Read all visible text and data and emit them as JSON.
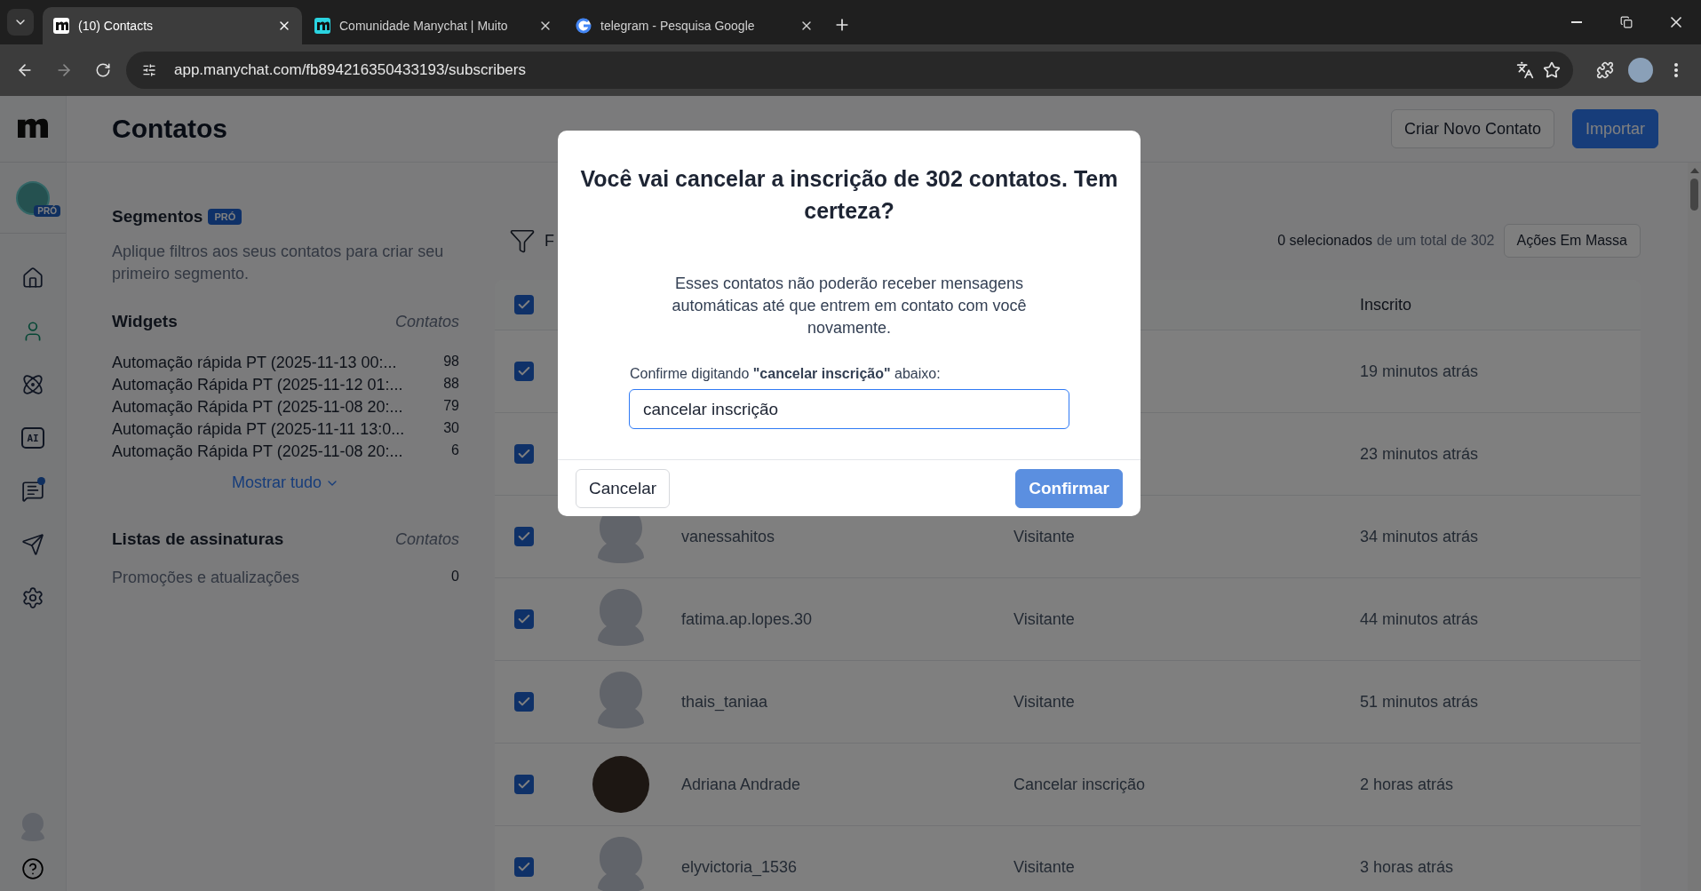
{
  "browser": {
    "tabs": [
      {
        "title": "(10) Contacts",
        "selected": true
      },
      {
        "title": "Comunidade Manychat | Muito",
        "selected": false
      },
      {
        "title": "telegram - Pesquisa Google",
        "selected": false
      }
    ],
    "url": "app.manychat.com/fb894216350433193/subscribers"
  },
  "nav": {
    "account_badge": "PRÓ",
    "items": [
      {
        "selected": false
      },
      {
        "selected": true
      },
      {
        "selected": false
      },
      {
        "selected": false,
        "label": "AI"
      },
      {
        "selected": false,
        "badge": true
      },
      {
        "selected": false
      },
      {
        "selected": false
      }
    ]
  },
  "header": {
    "title": "Contatos",
    "buttons": [
      {
        "label": "Criar Novo Contato",
        "kind": "secondary"
      },
      {
        "label": "Importar",
        "kind": "primary"
      }
    ]
  },
  "segments": {
    "title": "Segmentos",
    "badge": "PRÓ",
    "description": "Aplique filtros aos seus contatos para criar seu primeiro segmento."
  },
  "widgets": {
    "title": "Widgets",
    "column": "Contatos",
    "items": [
      {
        "name": "Automação rápida PT (2025-11-13 00:...",
        "count": "98"
      },
      {
        "name": "Automação Rápida PT (2025-11-12 01:...",
        "count": "88"
      },
      {
        "name": "Automação Rápida PT (2025-11-08 20:...",
        "count": "79"
      },
      {
        "name": "Automação rápida PT (2025-11-11 13:0...",
        "count": "30"
      },
      {
        "name": "Automação Rápida PT (2025-11-08 20:...",
        "count": "6"
      }
    ],
    "show_all": "Mostrar tudo"
  },
  "subscription_lists": {
    "title": "Listas de assinaturas",
    "column": "Contatos",
    "items": [
      {
        "name": "Promoções e atualizações",
        "count": "0"
      }
    ]
  },
  "toolbar": {
    "filter_label": "F",
    "selected_count": "0 selecionados",
    "total": "de um total de 302",
    "bulk_button": "Ações Em Massa"
  },
  "table": {
    "header_checked": true,
    "columns": [
      {
        "label": "Inscrito"
      }
    ],
    "rows": [
      {
        "checked": true,
        "subscribed": "19 minutos atrás"
      },
      {
        "checked": true,
        "subscribed": "23 minutos atrás"
      },
      {
        "checked": true,
        "kind": "silhouette",
        "name": "vanessahitos",
        "status": "Visitante",
        "subscribed": "34 minutos atrás"
      },
      {
        "checked": true,
        "kind": "silhouette",
        "name": "fatima.ap.lopes.30",
        "status": "Visitante",
        "subscribed": "44 minutos atrás"
      },
      {
        "checked": true,
        "kind": "silhouette",
        "name": "thais_taniaa",
        "status": "Visitante",
        "subscribed": "51 minutos atrás"
      },
      {
        "checked": true,
        "kind": "photo",
        "name": "Adriana Andrade",
        "status": "Cancelar inscrição",
        "subscribed": "2 horas atrás"
      },
      {
        "checked": true,
        "kind": "silhouette",
        "name": "elyvictoria_1536",
        "status": "Visitante",
        "subscribed": "3 horas atrás"
      }
    ]
  },
  "dialog": {
    "title": "Você vai cancelar a inscrição de 302 contatos. Tem certeza?",
    "message": "Esses contatos não poderão receber mensagens automáticas até que entrem em contato com você novamente.",
    "prompt": "Confirme digitando **\"cancelar inscrição\"** abaixo:",
    "input_value": "cancelar inscrição",
    "cancel": "Cancelar",
    "confirm": {
      "label": "Confirmar",
      "disabled": true
    }
  }
}
